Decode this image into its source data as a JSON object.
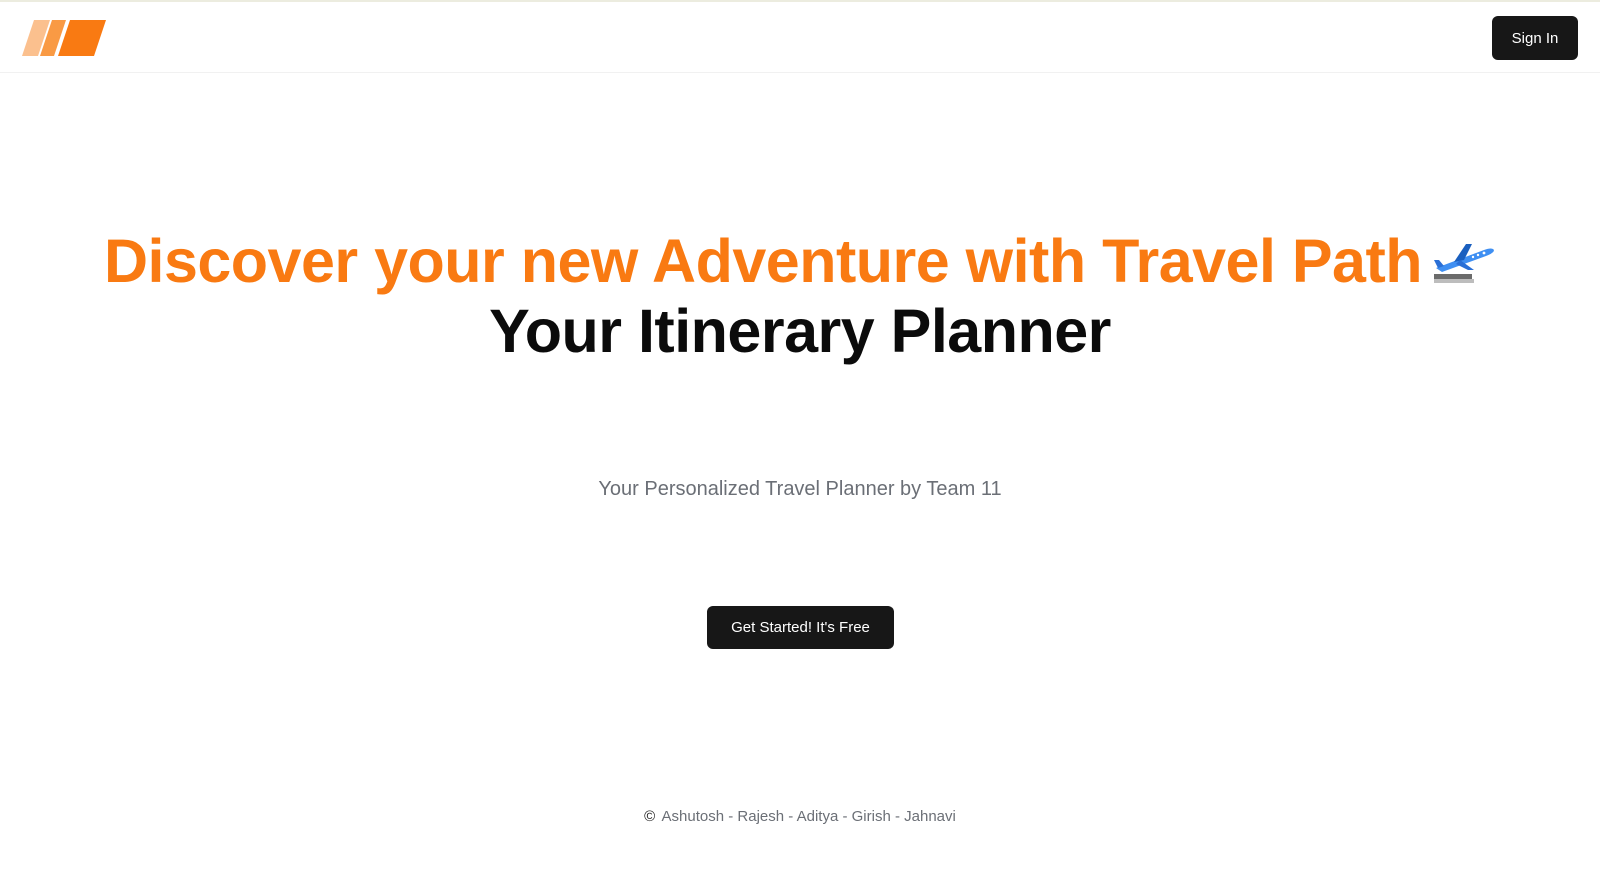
{
  "header": {
    "logo_icon": "stripes-logo-icon",
    "signin_label": "Sign In"
  },
  "hero": {
    "title": "Discover your new Adventure with Travel Path",
    "plane_icon": "airplane-icon",
    "subtitle": "Your Itinerary Planner",
    "tagline": "Your Personalized Travel Planner by Team 11",
    "cta_label": "Get Started! It's Free"
  },
  "footer": {
    "copyright_icon": "©",
    "text": "Ashutosh - Rajesh - Aditya - Girish - Jahnavi"
  },
  "colors": {
    "accent": "#f97a12",
    "button_bg": "#171717",
    "muted_text": "#6b6f76"
  }
}
